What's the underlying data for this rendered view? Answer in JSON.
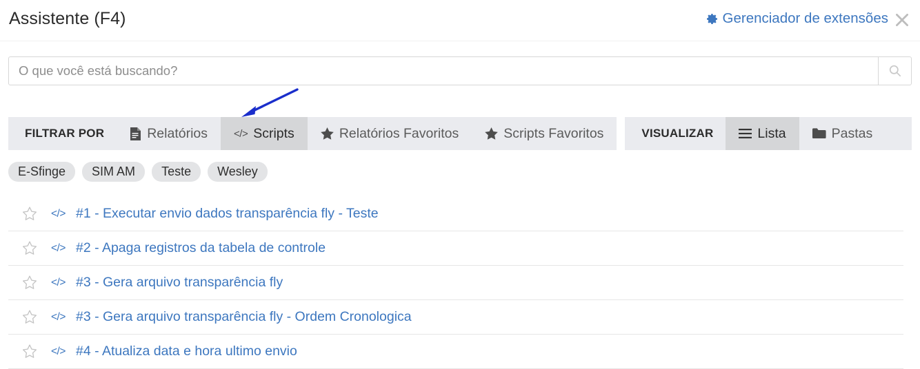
{
  "header": {
    "title": "Assistente (F4)",
    "extensions_link": "Gerenciador de extensões",
    "gear_icon": "gear-icon",
    "close_icon": "close-icon"
  },
  "search": {
    "placeholder": "O que você está buscando?",
    "value": "",
    "button_icon": "search-icon"
  },
  "annotation": {
    "type": "arrow",
    "color": "#1a2ecb",
    "points_to": "Scripts"
  },
  "filter_bar": {
    "filter_label": "FILTRAR POR",
    "tabs": [
      {
        "label": "Relatórios",
        "icon": "report-icon",
        "active": false
      },
      {
        "label": "Scripts",
        "icon": "code-icon",
        "active": true
      },
      {
        "label": "Relatórios Favoritos",
        "icon": "star-icon",
        "active": false
      },
      {
        "label": "Scripts Favoritos",
        "icon": "star-icon",
        "active": false
      }
    ],
    "view_label": "VISUALIZAR",
    "view_tabs": [
      {
        "label": "Lista",
        "icon": "list-icon",
        "active": true
      },
      {
        "label": "Pastas",
        "icon": "folder-icon",
        "active": false
      }
    ]
  },
  "chips": [
    {
      "label": "E-Sfinge"
    },
    {
      "label": "SIM AM"
    },
    {
      "label": "Teste"
    },
    {
      "label": "Wesley"
    }
  ],
  "list": {
    "rows": [
      {
        "star": "star-outline-icon",
        "icon": "code-icon",
        "label": "#1 - Executar envio dados transparência fly - Teste"
      },
      {
        "star": "star-outline-icon",
        "icon": "code-icon",
        "label": "#2 - Apaga registros da tabela de controle"
      },
      {
        "star": "star-outline-icon",
        "icon": "code-icon",
        "label": "#3 - Gera arquivo transparência fly"
      },
      {
        "star": "star-outline-icon",
        "icon": "code-icon",
        "label": "#3 - Gera arquivo transparência fly - Ordem Cronologica"
      },
      {
        "star": "star-outline-icon",
        "icon": "code-icon",
        "label": "#4 - Atualiza data e hora ultimo envio"
      }
    ]
  },
  "colors": {
    "link": "#3d77bf",
    "bar_bg": "#eaebef",
    "tab_active_bg": "#d5d6d8",
    "chip_bg": "#e3e4e6",
    "arrow": "#1a2ecb"
  }
}
